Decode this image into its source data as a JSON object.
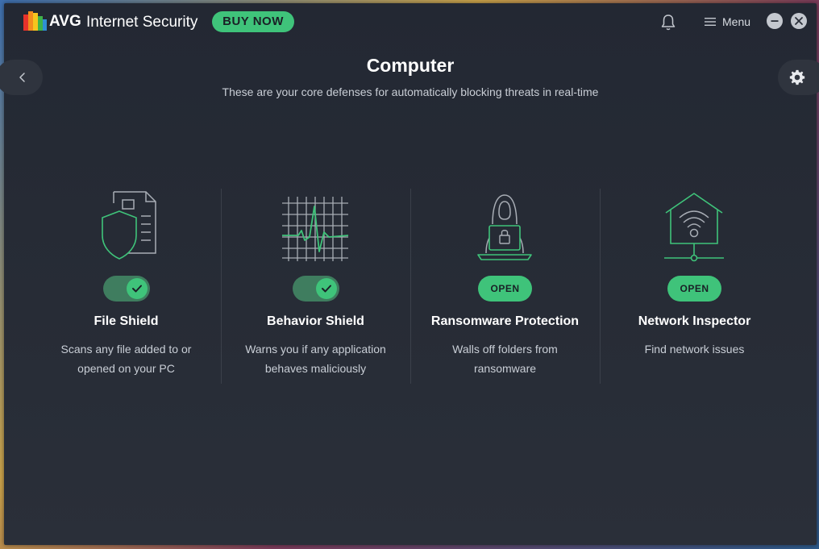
{
  "app": {
    "brand": "AVG",
    "product": "Internet Security",
    "buy_label": "BUY NOW",
    "menu_label": "Menu"
  },
  "page": {
    "title": "Computer",
    "subtitle": "These are your core defenses for automatically blocking threats in real-time"
  },
  "cards": [
    {
      "title": "File Shield",
      "description": "Scans any file added to or opened on your PC",
      "control": "toggle",
      "enabled": true,
      "icon": "file-shield-icon"
    },
    {
      "title": "Behavior Shield",
      "description": "Warns you if any application behaves maliciously",
      "control": "toggle",
      "enabled": true,
      "icon": "behavior-chart-icon"
    },
    {
      "title": "Ransomware Protection",
      "description": "Walls off folders from ransomware",
      "control": "button",
      "button_label": "OPEN",
      "icon": "ransomware-lock-icon"
    },
    {
      "title": "Network Inspector",
      "description": "Find network issues",
      "control": "button",
      "button_label": "OPEN",
      "icon": "home-network-icon"
    }
  ],
  "colors": {
    "accent": "#3fc37a",
    "toggle_track": "#3f7d5f",
    "background": "#262b35",
    "icon_stroke": "#3fc37a",
    "icon_gray": "#a8adb5"
  }
}
